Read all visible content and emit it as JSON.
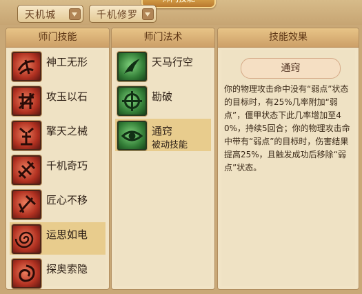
{
  "window": {
    "title": "师门技能"
  },
  "dropdowns": [
    {
      "label": "天机城"
    },
    {
      "label": "千机修罗"
    }
  ],
  "panels": {
    "skills": {
      "header": "师门技能",
      "items": [
        {
          "label": "神工无形"
        },
        {
          "label": "攻玉以石"
        },
        {
          "label": "擎天之械"
        },
        {
          "label": "千机奇巧"
        },
        {
          "label": "匠心不移"
        },
        {
          "label": "运思如电"
        },
        {
          "label": "探奥索隐"
        }
      ]
    },
    "arts": {
      "header": "师门法术",
      "items": [
        {
          "label": "天马行空"
        },
        {
          "label": "勘破"
        },
        {
          "label": "通窍",
          "sub": "被动技能"
        }
      ]
    },
    "effect": {
      "header": "技能效果",
      "skill_name": "通窍",
      "description": "你的物理攻击命中没有“弱点”状态的目标时，有25%几率附加“弱点”，僵甲状态下此几率增加至40%，持续5回合；你的物理攻击命中带有“弱点”的目标时，伤害结果提高25%，且触发成功后移除“弱点”状态。"
    }
  }
}
